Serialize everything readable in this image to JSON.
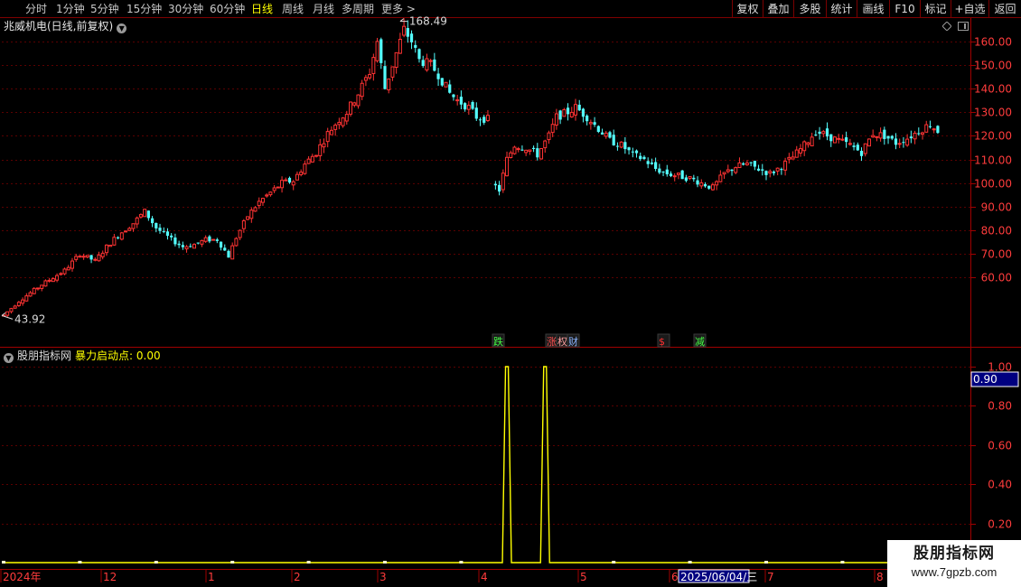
{
  "toolbar": {
    "periods": [
      {
        "label": "分时",
        "active": false
      },
      {
        "label": "1分钟",
        "active": false
      },
      {
        "label": "5分钟",
        "active": false
      },
      {
        "label": "15分钟",
        "active": false
      },
      {
        "label": "30分钟",
        "active": false
      },
      {
        "label": "60分钟",
        "active": false
      },
      {
        "label": "日线",
        "active": true
      },
      {
        "label": "周线",
        "active": false
      },
      {
        "label": "月线",
        "active": false
      },
      {
        "label": "多周期",
        "active": false
      },
      {
        "label": "更多 >",
        "active": false
      }
    ],
    "actions": [
      "复权",
      "叠加",
      "多股",
      "统计",
      "画线",
      "F10",
      "标记",
      "+自选",
      "返回"
    ]
  },
  "main_chart": {
    "title": "兆威机电(日线,前复权)",
    "max_label": "168.49",
    "min_label": "43.92",
    "signals": [
      {
        "text": "跌",
        "color": "#44ff44"
      },
      {
        "text": "涨",
        "color": "#ff5050"
      },
      {
        "text": "权",
        "color": "#ffa0a0"
      },
      {
        "text": "财",
        "color": "#8ab4ff"
      },
      {
        "text": "$",
        "color": "#ff3030"
      },
      {
        "text": "减",
        "color": "#44ff44"
      }
    ],
    "up_color": "#ff3333",
    "down_color": "#54ffff"
  },
  "indicator": {
    "name": "股朋指标网",
    "label": "暴力启动点: 0.00",
    "current_value": "0.90",
    "line_color": "#ffff00"
  },
  "timeline": {
    "labels": [
      "2024年",
      "12",
      "1",
      "2",
      "3",
      "4",
      "5",
      "6",
      "7",
      "8"
    ],
    "cursor_date": "2025/06/04/三"
  },
  "watermark": {
    "title": "股朋指标网",
    "url": "www.7gpzb.com"
  },
  "chart_data": [
    {
      "type": "candlestick",
      "title": "兆威机电(日线,前复权)",
      "y_ticks": [
        60,
        70,
        80,
        90,
        100,
        110,
        120,
        130,
        140,
        150,
        160
      ],
      "ylim": [
        42,
        170
      ],
      "grid": true,
      "annotations": {
        "high": 168.49,
        "low": 43.92
      },
      "close_path": [
        [
          0,
          44
        ],
        [
          4,
          50
        ],
        [
          10,
          57
        ],
        [
          16,
          63
        ],
        [
          20,
          70
        ],
        [
          24,
          67
        ],
        [
          27,
          73
        ],
        [
          30,
          78
        ],
        [
          34,
          83
        ],
        [
          37,
          88
        ],
        [
          40,
          81
        ],
        [
          44,
          76
        ],
        [
          47,
          73
        ],
        [
          50,
          74
        ],
        [
          53,
          76
        ],
        [
          56,
          76
        ],
        [
          59,
          69
        ],
        [
          61,
          77
        ],
        [
          64,
          86
        ],
        [
          67,
          92
        ],
        [
          70,
          96
        ],
        [
          73,
          100
        ],
        [
          76,
          101
        ],
        [
          79,
          108
        ],
        [
          82,
          113
        ],
        [
          85,
          121
        ],
        [
          88,
          127
        ],
        [
          90,
          130
        ],
        [
          93,
          138
        ],
        [
          96,
          147
        ],
        [
          98,
          160
        ],
        [
          100,
          140
        ],
        [
          103,
          155
        ],
        [
          105,
          165
        ],
        [
          107,
          160
        ],
        [
          109,
          152
        ],
        [
          112,
          150
        ],
        [
          114,
          146
        ],
        [
          117,
          138
        ],
        [
          119,
          135
        ],
        [
          122,
          132
        ],
        [
          124,
          128
        ],
        [
          127,
          127
        ],
        [
          128,
          100
        ],
        [
          130,
          97
        ],
        [
          132,
          110
        ],
        [
          134,
          116
        ],
        [
          137,
          115
        ],
        [
          140,
          112
        ],
        [
          143,
          120
        ],
        [
          145,
          128
        ],
        [
          148,
          130
        ],
        [
          150,
          132
        ],
        [
          153,
          128
        ],
        [
          156,
          123
        ],
        [
          159,
          118
        ],
        [
          162,
          116
        ],
        [
          165,
          112
        ],
        [
          168,
          110
        ],
        [
          171,
          106
        ],
        [
          174,
          104
        ],
        [
          177,
          103
        ],
        [
          180,
          102
        ],
        [
          183,
          100
        ],
        [
          186,
          98
        ],
        [
          189,
          104
        ],
        [
          192,
          107
        ],
        [
          195,
          108
        ],
        [
          198,
          106
        ],
        [
          201,
          104
        ],
        [
          204,
          107
        ],
        [
          207,
          111
        ],
        [
          210,
          116
        ],
        [
          213,
          122
        ],
        [
          216,
          120
        ],
        [
          219,
          118
        ],
        [
          222,
          116
        ],
        [
          225,
          113
        ],
        [
          228,
          121
        ],
        [
          231,
          120
        ],
        [
          234,
          117
        ],
        [
          237,
          119
        ],
        [
          240,
          122
        ],
        [
          243,
          125
        ],
        [
          245,
          122
        ]
      ]
    },
    {
      "type": "line",
      "title": "暴力启动点",
      "y_ticks": [
        0.2,
        0.4,
        0.6,
        0.8,
        1.0
      ],
      "ylim": [
        -0.02,
        1.02
      ],
      "values": "0 everywhere except two single-bar spikes to 1.0 (around 2025-04-08 and 2025-04-18)",
      "spikes": [
        {
          "bar_index": 132,
          "value": 1.0
        },
        {
          "bar_index": 142,
          "value": 1.0
        }
      ]
    }
  ]
}
